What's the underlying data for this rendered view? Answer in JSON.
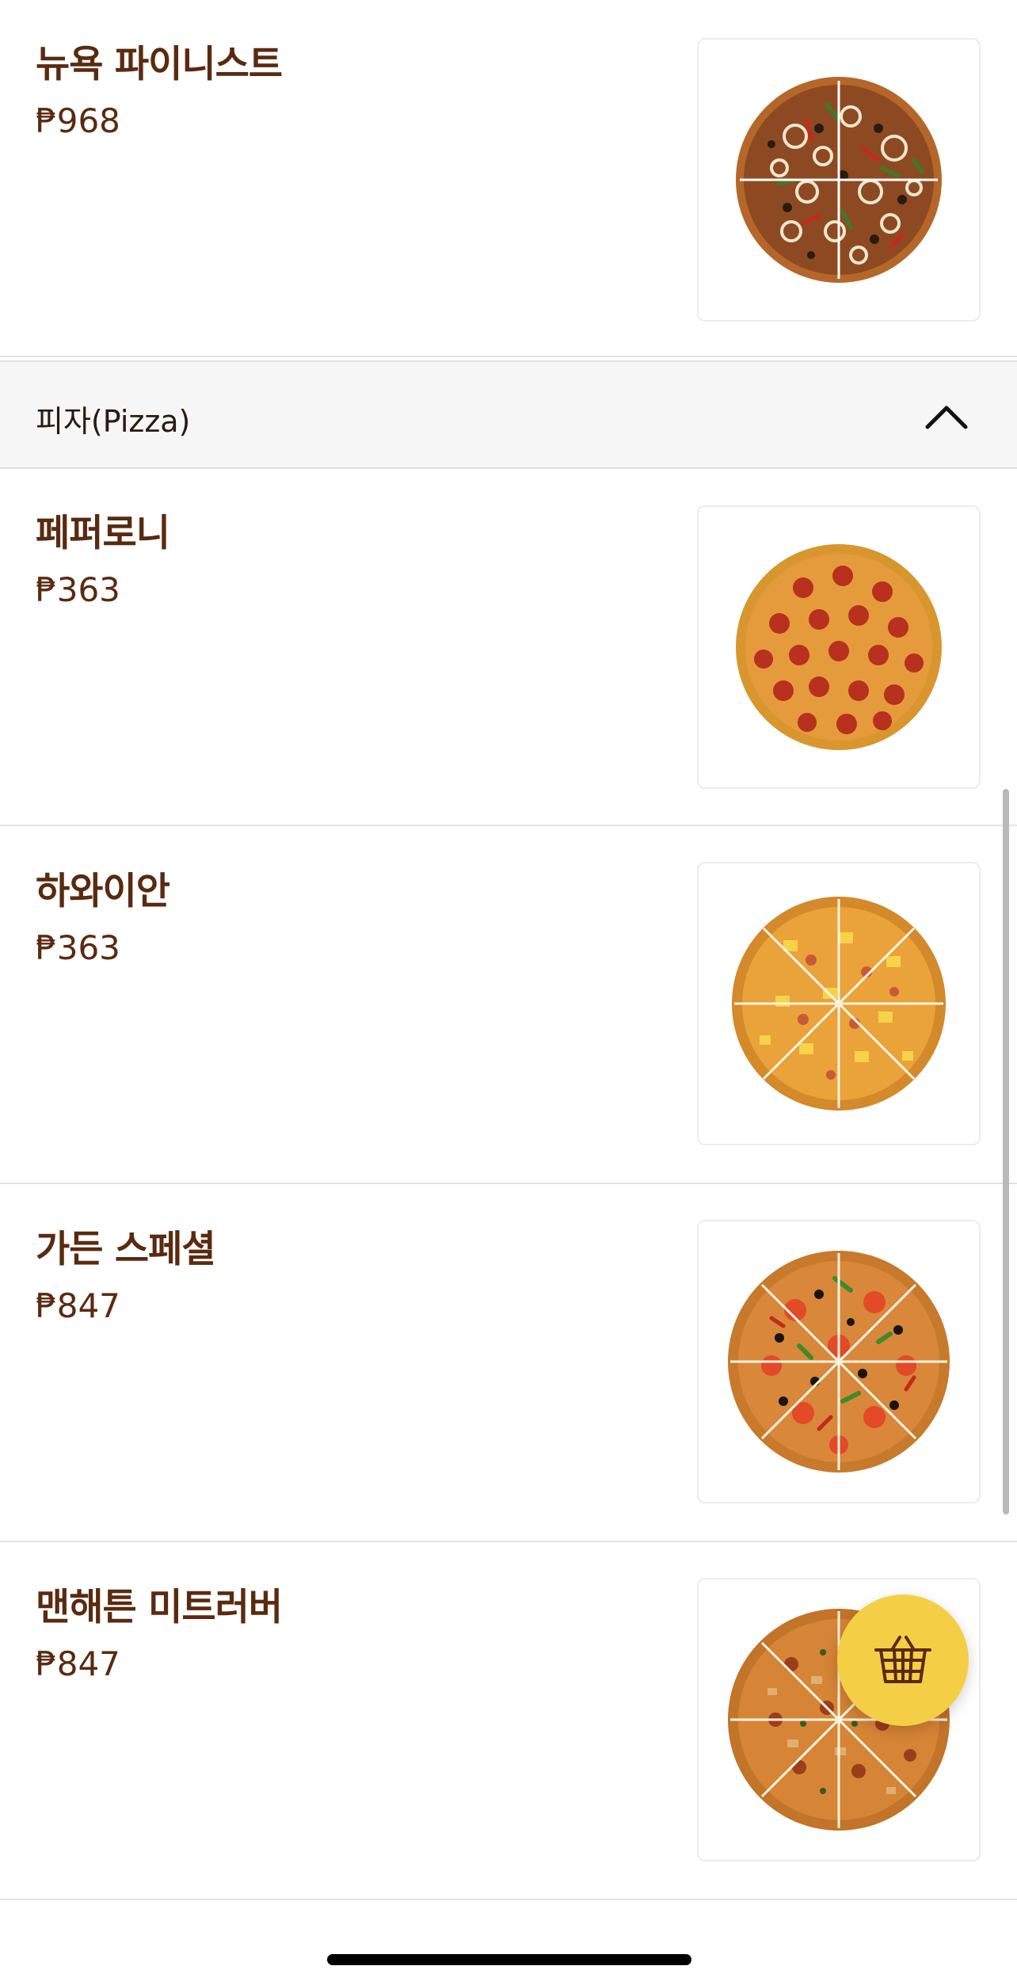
{
  "featured": {
    "name": "뉴욕 파이니스트",
    "price": "₱968",
    "image_icon": "new-york-finest-pizza-image"
  },
  "category": {
    "label": "피자(Pizza)",
    "toggle_icon": "chevron-up-icon"
  },
  "items": [
    {
      "name": "페퍼로니",
      "price": "₱363",
      "image_icon": "pepperoni-pizza-image"
    },
    {
      "name": "하와이안",
      "price": "₱363",
      "image_icon": "hawaiian-pizza-image"
    },
    {
      "name": "가든 스페셜",
      "price": "₱847",
      "image_icon": "garden-special-pizza-image"
    },
    {
      "name": "맨해튼 미트러버",
      "price": "₱847",
      "image_icon": "manhattan-meatlovers-pizza-image"
    }
  ],
  "cart_button": {
    "icon": "basket-icon"
  },
  "colors": {
    "text_brown": "#5a2a10",
    "cart_yellow": "#f4cf46",
    "category_bg": "#f6f6f6",
    "divider": "#e3e3e3"
  }
}
